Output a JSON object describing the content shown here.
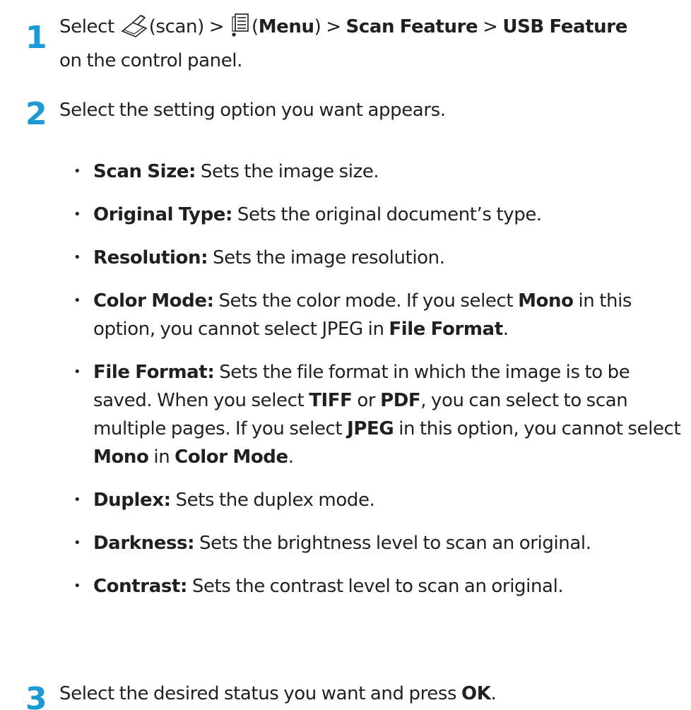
{
  "colors": {
    "step_number": "#1a9ad6",
    "text": "#231f20"
  },
  "step1": {
    "number": "1",
    "select": "Select",
    "scan_icon": "scanner-icon",
    "scan_label": "(scan) >",
    "menu_icon": "menu-icon",
    "menu_open": "(",
    "menu_label": "Menu",
    "menu_close": ") > ",
    "scan_feature": "Scan Feature",
    "sep": " > ",
    "usb_feature": "USB Feature",
    "tail": "on the control panel."
  },
  "step2": {
    "number": "2",
    "text": "Select the setting option you want appears.",
    "options": [
      {
        "name": "Scan Size:",
        "desc": " Sets the image size."
      },
      {
        "name": "Original Type:",
        "desc": " Sets the original document’s type."
      },
      {
        "name": "Resolution:",
        "desc": " Sets the image resolution."
      },
      {
        "name": "Color Mode:",
        "desc_a": " Sets the color mode. If you select ",
        "bold_a": "Mono",
        "desc_b": " in this option, you cannot select JPEG in ",
        "bold_b": "File Format",
        "desc_c": "."
      },
      {
        "name": "File Format:",
        "desc_a": " Sets the file format in which the image is to be saved. When you select ",
        "bold_a": "TIFF",
        "desc_b": " or ",
        "bold_b": "PDF",
        "desc_c": ", you can select to scan multiple pages. If you select ",
        "bold_c": "JPEG",
        "desc_d": " in this option, you cannot select ",
        "bold_d": "Mono",
        "desc_e": " in ",
        "bold_e": "Color  Mode",
        "desc_f": "."
      },
      {
        "name": "Duplex:",
        "desc": " Sets the duplex mode."
      },
      {
        "name": "Darkness:",
        "desc": " Sets the brightness level to scan an original."
      },
      {
        "name": "Contrast:",
        "desc": " Sets the contrast level to scan an original."
      }
    ]
  },
  "step3": {
    "number": "3",
    "text": "Select the desired status you want and press ",
    "ok": "OK",
    "end": "."
  }
}
